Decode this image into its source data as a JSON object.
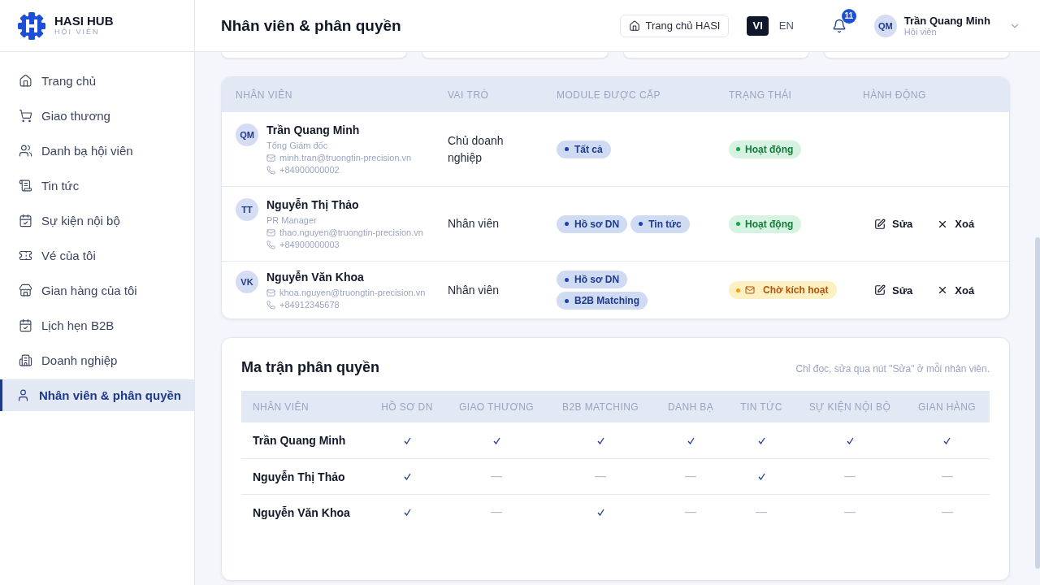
{
  "brand": {
    "name": "HASI HUB",
    "subtitle": "HỘI VIÊN"
  },
  "sidebar": {
    "items": [
      {
        "label": "Trang chủ",
        "selected": false
      },
      {
        "label": "Giao thương",
        "selected": false
      },
      {
        "label": "Danh bạ hội viên",
        "selected": false
      },
      {
        "label": "Tin tức",
        "selected": false
      },
      {
        "label": "Sự kiện nội bộ",
        "selected": false
      },
      {
        "label": "Vé của tôi",
        "selected": false
      },
      {
        "label": "Gian hàng của tôi",
        "selected": false
      },
      {
        "label": "Lịch hẹn B2B",
        "selected": false
      },
      {
        "label": "Doanh nghiệp",
        "selected": false
      },
      {
        "label": "Nhân viên & phân quyền",
        "selected": true
      }
    ]
  },
  "header": {
    "title": "Nhân viên & phân quyền",
    "home_button": "Trang chủ HASI",
    "languages": [
      {
        "label": "VI",
        "selected": true
      },
      {
        "label": "EN",
        "selected": false
      }
    ],
    "notifications": "11",
    "user": {
      "initials": "QM",
      "name": "Trần Quang Minh",
      "role": "Hội viên"
    }
  },
  "staff_table": {
    "columns": [
      "NHÂN VIÊN",
      "VAI TRÒ",
      "MODULE ĐƯỢC CẤP",
      "TRẠNG THÁI",
      "HÀNH ĐỘNG"
    ],
    "rows": [
      {
        "initials": "QM",
        "name": "Trần Quang Minh",
        "title": "Tổng Giám đốc",
        "email": "minh.tran@truongtin-precision.vn",
        "phone": "+84900000002",
        "role": "Chủ doanh nghiệp",
        "modules": [
          "Tất cả"
        ],
        "status": {
          "kind": "active",
          "label": "Hoạt động"
        },
        "actions": []
      },
      {
        "initials": "TT",
        "name": "Nguyễn Thị Thảo",
        "title": "PR Manager",
        "email": "thao.nguyen@truongtin-precision.vn",
        "phone": "+84900000003",
        "role": "Nhân viên",
        "modules": [
          "Hồ sơ DN",
          "Tin tức"
        ],
        "status": {
          "kind": "active",
          "label": "Hoạt động"
        },
        "actions": [
          {
            "kind": "edit",
            "label": "Sửa"
          },
          {
            "kind": "delete",
            "label": "Xoá"
          }
        ]
      },
      {
        "initials": "VK",
        "name": "Nguyễn Văn Khoa",
        "email": "khoa.nguyen@truongtin-precision.vn",
        "phone": "+84912345678",
        "role": "Nhân viên",
        "modules": [
          "Hồ sơ DN",
          "B2B Matching"
        ],
        "status": {
          "kind": "pending",
          "label": "Chờ kích hoạt"
        },
        "actions": [
          {
            "kind": "edit",
            "label": "Sửa"
          },
          {
            "kind": "delete",
            "label": "Xoá"
          }
        ]
      }
    ]
  },
  "matrix": {
    "title": "Ma trận phân quyền",
    "note": "Chỉ đọc, sửa qua nút \"Sửa\" ở mỗi nhân viên.",
    "columns": [
      "NHÂN VIÊN",
      "HỒ SƠ DN",
      "GIAO THƯƠNG",
      "B2B MATCHING",
      "DANH BẠ",
      "TIN TỨC",
      "SỰ KIỆN NỘI BỘ",
      "GIAN HÀNG"
    ],
    "rows": [
      {
        "name": "Trần Quang Minh",
        "permissions": [
          true,
          true,
          true,
          true,
          true,
          true,
          true
        ]
      },
      {
        "name": "Nguyễn Thị Thảo",
        "permissions": [
          true,
          false,
          false,
          false,
          true,
          false,
          false
        ]
      },
      {
        "name": "Nguyễn Văn Khoa",
        "permissions": [
          true,
          false,
          true,
          false,
          false,
          false,
          false
        ]
      }
    ]
  }
}
